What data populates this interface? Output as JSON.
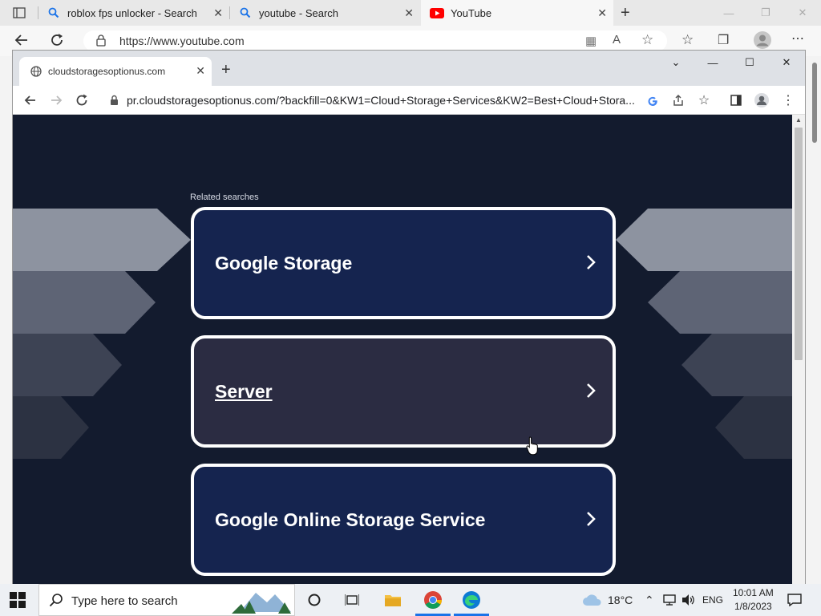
{
  "edge": {
    "tabs": [
      {
        "label": "roblox fps unlocker - Search"
      },
      {
        "label": "youtube - Search"
      },
      {
        "label": "YouTube"
      }
    ],
    "address": "https://www.youtube.com"
  },
  "chrome": {
    "tab_title": "cloudstoragesoptionus.com",
    "url": "pr.cloudstoragesoptionus.com/?backfill=0&KW1=Cloud+Storage+Services&KW2=Best+Cloud+Stora..."
  },
  "page": {
    "related_label": "Related searches",
    "results": [
      {
        "label": "Google Storage"
      },
      {
        "label": "Server"
      },
      {
        "label": "Google Online Storage Service"
      }
    ]
  },
  "taskbar": {
    "search_placeholder": "Type here to search",
    "weather": "18°C",
    "language": "ENG",
    "time": "10:01 AM",
    "date": "1/8/2023"
  },
  "colors": {
    "page_bg": "#131b2e",
    "card_primary": "#15244f",
    "card_hover": "#2b2c42"
  }
}
